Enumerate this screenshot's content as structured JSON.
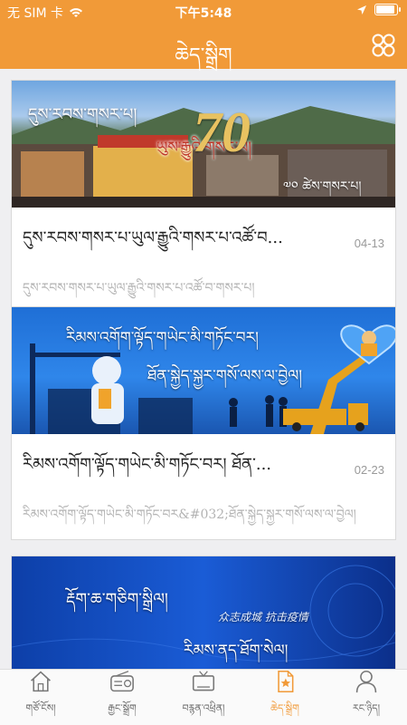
{
  "status_bar": {
    "carrier": "无 SIM 卡",
    "time": "下午5:48"
  },
  "header": {
    "title": "ཆེད་སྒྲིག",
    "menu_icon": "grid-icon"
  },
  "articles": [
    {
      "image_caption": "དུས་རབས་གསར་པ།",
      "image_caption_2": "ཡུས་རྒྱུའི་གསར་པ།",
      "image_caption_3": "༧༠ ཚེས་གསར་པ།",
      "image_number": "70",
      "title": "དུས་རབས་གསར་པ་ཡུལ་རྒྱུའི་གསར་པ་འཚོ་བ...",
      "date": "04-13",
      "description": "དུས་རབས་གསར་པ་ཡུལ་རྒྱུའི་གསར་པ་འཚོ་བ་གསར་པ།"
    },
    {
      "image_caption": "རིམས་འགོག་ལྟོད་གཡེང་མི་གཏོང་བར།",
      "image_caption_2": "ཐོན་སྐྱེད་སྐྱར་གསོ་ལས་ལ་བྱེལ།",
      "title": "རིམས་འགོག་ལྟོད་གཡེང་མི་གཏོང་བར། ཐོན་...",
      "date": "02-23",
      "description": "རིམས་འགོག་ལྟོད་གཡེང་མི་གཏོང་བར&#032;ཐོན་སྐྱེད་སྐྱར་གསོ་ལས་ལ་བྱེལ།"
    },
    {
      "image_caption": "རྡོག་ཆ་གཅིག་སྒྲིལ།",
      "image_caption_2": "众志成城  抗击疫情",
      "image_caption_3": "རིམས་ནད་ཐོག་སེལ།"
    }
  ],
  "tabs": [
    {
      "label": "གཙོ་ངོས།",
      "icon": "home-icon",
      "active": false
    },
    {
      "label": "རྒྱང་སྒྲོག",
      "icon": "radio-icon",
      "active": false
    },
    {
      "label": "བརྙན་འཕྲིན།",
      "icon": "tv-icon",
      "active": false
    },
    {
      "label": "ཆེད་སྒྲིག",
      "icon": "special-topic-icon",
      "active": true
    },
    {
      "label": "རང་ཉིད།",
      "icon": "user-icon",
      "active": false
    }
  ],
  "colors": {
    "brand": "#f19a38",
    "background": "#efeff1"
  }
}
